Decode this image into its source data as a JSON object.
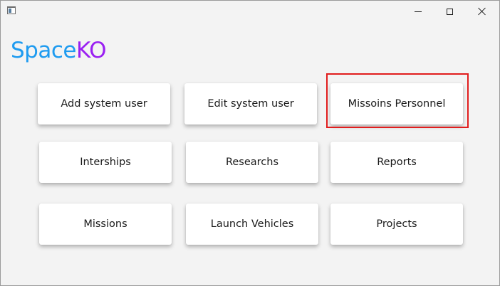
{
  "window": {
    "controls": {
      "minimize_icon": "minimize-icon",
      "maximize_icon": "maximize-icon",
      "close_icon": "close-icon"
    }
  },
  "brand": {
    "part1": "Space",
    "part2": "KO",
    "colors": {
      "part1": "#1e9bf0",
      "part2": "#9a1ff2"
    }
  },
  "menu": {
    "row1": [
      "Add system user",
      "Edit system user",
      "Missoins Personnel"
    ],
    "row2": [
      "Interships",
      "Researchs",
      "Reports"
    ],
    "row3": [
      "Missions",
      "Launch Vehicles",
      "Projects"
    ]
  },
  "highlight_color": "#e11d1d"
}
